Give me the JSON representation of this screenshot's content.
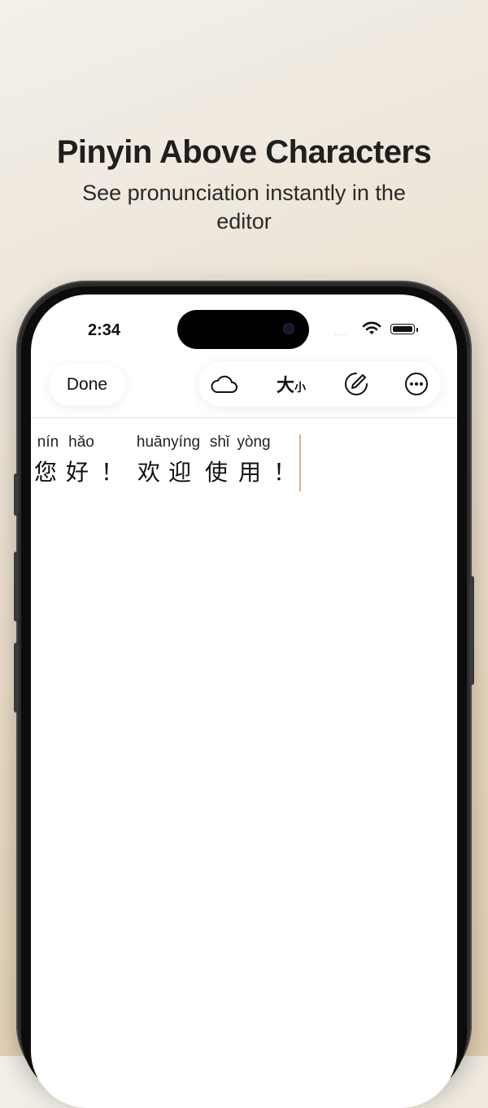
{
  "promo": {
    "headline": "Pinyin Above Characters",
    "subline": "See pronunciation instantly in the editor"
  },
  "status_bar": {
    "time": "2:34",
    "signal": "····"
  },
  "toolbar": {
    "done_label": "Done",
    "icons": [
      "cloud-icon",
      "text-size-icon",
      "edit-circle-icon",
      "more-icon"
    ],
    "size_big": "大",
    "size_small": "小"
  },
  "editor": {
    "words": [
      {
        "pinyin": "nín",
        "hanzi": "您"
      },
      {
        "pinyin": "hǎo",
        "hanzi": "好"
      },
      {
        "pinyin": "",
        "hanzi": "！"
      },
      {
        "pinyin": "huānyíng",
        "hanzi": "欢迎"
      },
      {
        "pinyin": "shǐ",
        "hanzi": "使"
      },
      {
        "pinyin": "yòng",
        "hanzi": "用"
      },
      {
        "pinyin": "",
        "hanzi": "！"
      }
    ]
  },
  "colors": {
    "cursor": "#d1b48c",
    "background_top": "#f3f0ea",
    "background_bottom": "#e2cfb2"
  }
}
